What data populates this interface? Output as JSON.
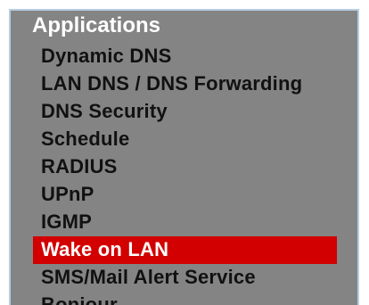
{
  "menu": {
    "title": "Applications",
    "items": [
      {
        "label": "Dynamic DNS",
        "active": false
      },
      {
        "label": "LAN DNS / DNS Forwarding",
        "active": false
      },
      {
        "label": "DNS Security",
        "active": false
      },
      {
        "label": "Schedule",
        "active": false
      },
      {
        "label": "RADIUS",
        "active": false
      },
      {
        "label": "UPnP",
        "active": false
      },
      {
        "label": "IGMP",
        "active": false
      },
      {
        "label": "Wake on LAN",
        "active": true
      },
      {
        "label": "SMS/Mail Alert Service",
        "active": false
      },
      {
        "label": "Bonjour",
        "active": false
      }
    ]
  },
  "colors": {
    "panel_background": "#848484",
    "selected_background": "#d20000",
    "title_text": "#ffffff",
    "item_text": "#111111",
    "border": "#b7ccdf"
  }
}
